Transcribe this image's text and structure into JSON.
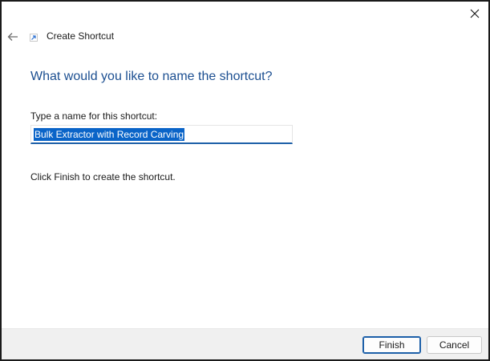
{
  "window": {
    "title": "Create Shortcut"
  },
  "icons": {
    "close": "close-icon",
    "back": "back-arrow-icon",
    "wizard": "shortcut-icon"
  },
  "page": {
    "heading": "What would you like to name the shortcut?",
    "name_label": "Type a name for this shortcut:",
    "name_value": "Bulk Extractor with Record Carving",
    "instruction": "Click Finish to create the shortcut."
  },
  "footer": {
    "finish_label": "Finish",
    "cancel_label": "Cancel"
  },
  "colors": {
    "heading": "#1c4f91",
    "accent": "#1c5fa8",
    "selection": "#0a64c8",
    "footer_bg": "#f0f0f0"
  }
}
